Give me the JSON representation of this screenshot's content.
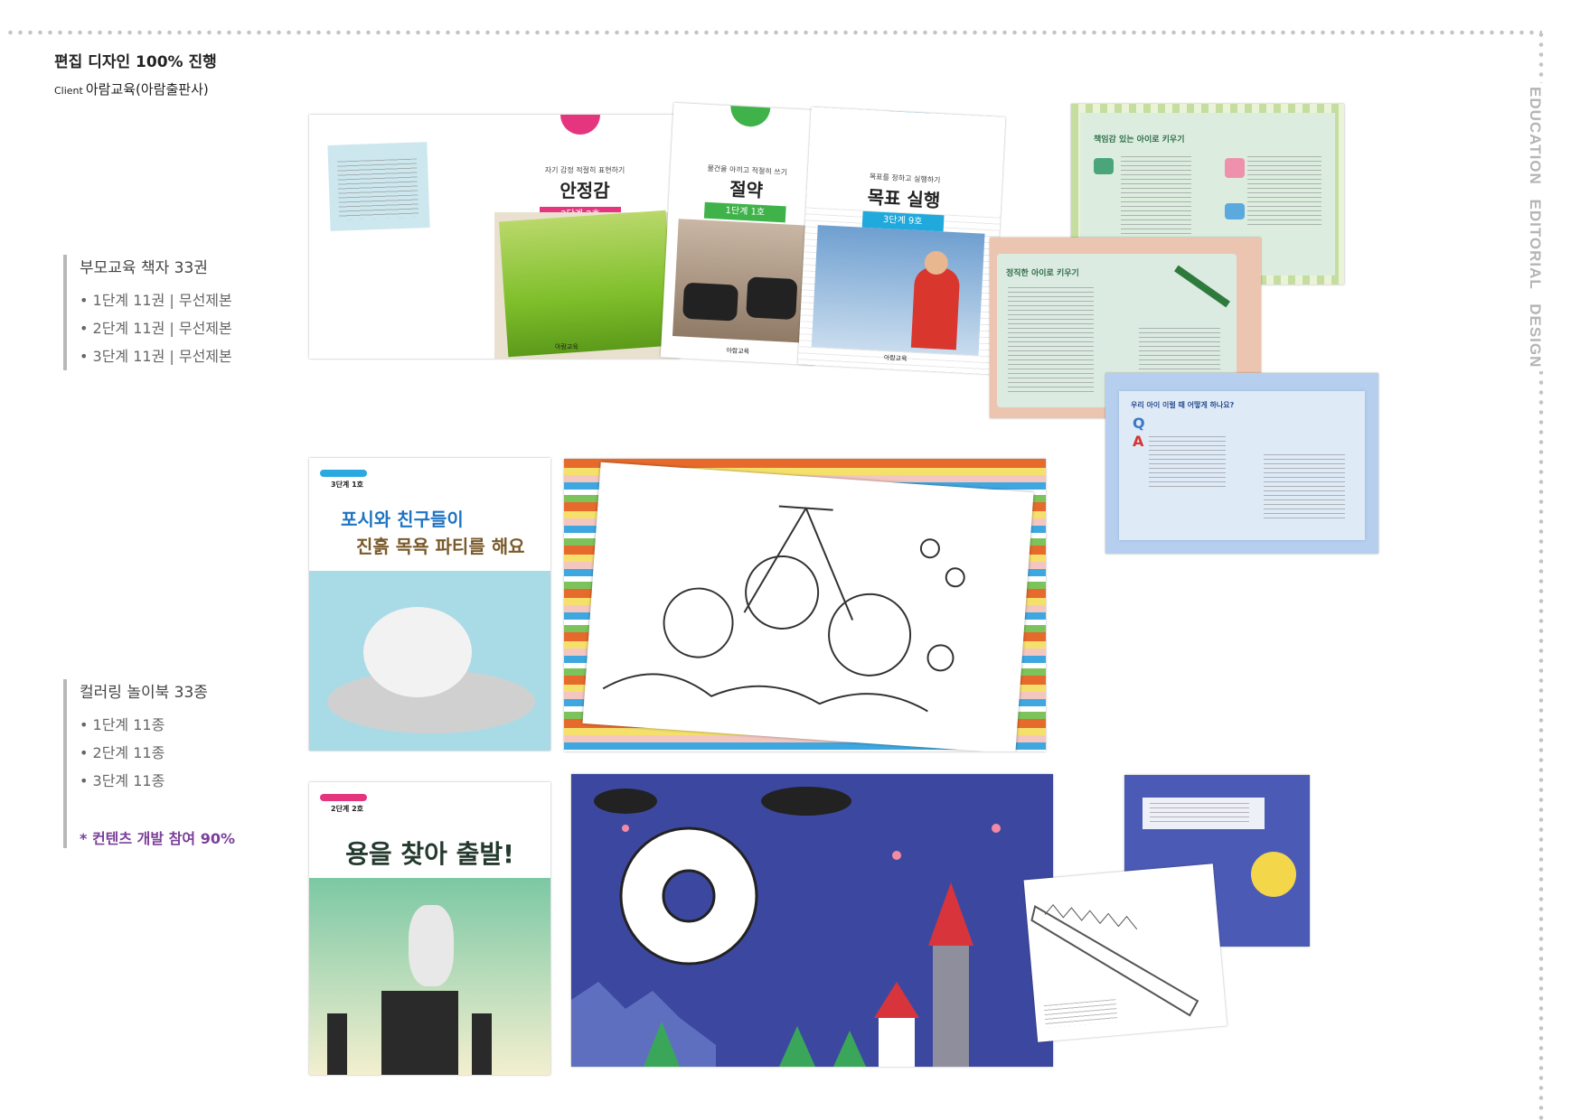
{
  "header": {
    "title": "편집 디자인 100% 진행",
    "client_label": "Client",
    "client_name": "아람교육(아람출판사)"
  },
  "side_label": "EDUCATION EDITORIAL DESIGN",
  "sections": [
    {
      "heading": "부모교육 책자 33권",
      "items": [
        "• 1단계 11권 | 무선제본",
        "• 2단계 11권 | 무선제본",
        "• 3단계 11권 | 무선제본"
      ]
    },
    {
      "heading": "컬러링 놀이북 33종",
      "items": [
        "• 1단계 11종",
        "• 2단계 11종",
        "• 3단계 11종"
      ],
      "note": "* 컨텐츠 개발 참여 90%"
    }
  ],
  "parent_books": [
    {
      "subtitle": "자기 감정 적절히 표현하기",
      "title": "안정감",
      "tag": "2단계 2호",
      "color": "#e6357f"
    },
    {
      "subtitle": "물건을 아끼고 적절히 쓰기",
      "title": "절약",
      "tag": "1단계 1호",
      "color": "#3fb24a"
    },
    {
      "subtitle": "목표를 정하고 실행하기",
      "title": "목표 실행",
      "tag": "3단계 9호",
      "color": "#1fa9dc"
    }
  ],
  "spreads": [
    {
      "title": "책임감 있는 아이로 키우기"
    },
    {
      "title": "정직한 아이로 키우기"
    },
    {
      "title": "우리 아이 이럴 때 어떻게 하나요?"
    }
  ],
  "coloring_books": [
    {
      "level": "3단계 1호",
      "title_line1": "포시와 친구들이",
      "title_line2": "진흙 목욕 파티를 해요"
    },
    {
      "level": "2단계 2호",
      "title": "용을 찾아 출발!"
    }
  ],
  "publisher": "아람교육"
}
